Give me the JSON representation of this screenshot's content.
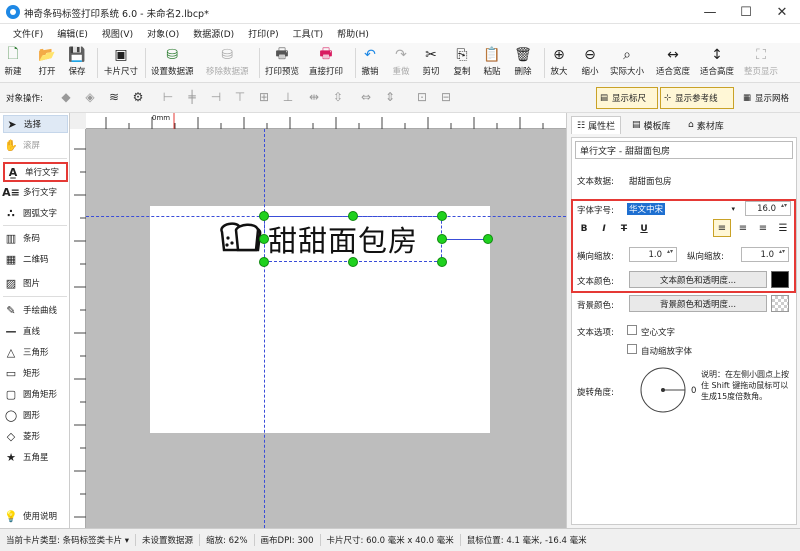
{
  "window": {
    "title": "神奇条码标签打印系统 6.0 - 未命名2.lbcp*",
    "minimize": "—",
    "maximize": "☐",
    "close": "✕"
  },
  "menu": [
    "文件(F)",
    "编辑(E)",
    "视图(V)",
    "对象(O)",
    "数据源(D)",
    "打印(P)",
    "工具(T)",
    "帮助(H)"
  ],
  "toolbar": [
    {
      "label": "新建",
      "icon": "new-file-icon",
      "glyph": "🗋"
    },
    {
      "label": "打开",
      "icon": "open-folder-icon",
      "glyph": "📂"
    },
    {
      "label": "保存",
      "icon": "save-disk-icon",
      "glyph": "💾"
    },
    {
      "label": "卡片尺寸",
      "icon": "card-size-icon",
      "glyph": "▣"
    },
    {
      "label": "设置数据源",
      "icon": "database-icon",
      "glyph": "⛁"
    },
    {
      "label": "移除数据源",
      "icon": "remove-database-icon",
      "glyph": "⛁"
    },
    {
      "label": "打印预览",
      "icon": "print-preview-icon",
      "glyph": "🖶"
    },
    {
      "label": "直接打印",
      "icon": "printer-icon",
      "glyph": "🖶"
    },
    {
      "label": "撤销",
      "icon": "undo-icon",
      "glyph": "↶"
    },
    {
      "label": "重做",
      "icon": "redo-icon",
      "glyph": "↷"
    },
    {
      "label": "剪切",
      "icon": "scissors-icon",
      "glyph": "✂"
    },
    {
      "label": "复制",
      "icon": "copy-icon",
      "glyph": "⎘"
    },
    {
      "label": "粘贴",
      "icon": "paste-icon",
      "glyph": "📋"
    },
    {
      "label": "删除",
      "icon": "trash-icon",
      "glyph": "🗑"
    },
    {
      "label": "放大",
      "icon": "zoom-in-icon",
      "glyph": "⊕"
    },
    {
      "label": "缩小",
      "icon": "zoom-out-icon",
      "glyph": "⊖"
    },
    {
      "label": "实际大小",
      "icon": "actual-size-icon",
      "glyph": "⌕"
    },
    {
      "label": "适合宽度",
      "icon": "fit-width-icon",
      "glyph": "↔"
    },
    {
      "label": "适合高度",
      "icon": "fit-height-icon",
      "glyph": "↕"
    },
    {
      "label": "整页显示",
      "icon": "full-page-icon",
      "glyph": "⛶"
    }
  ],
  "objbar": {
    "label": "对象操作:",
    "show_ruler": "显示标尺",
    "show_guides": "显示参考线",
    "show_grid": "显示网格"
  },
  "tools": [
    {
      "label": "选择",
      "glyph": "➤"
    },
    {
      "label": "滚屏",
      "glyph": "✋"
    },
    {
      "label": "单行文字",
      "glyph": "A̲"
    },
    {
      "label": "多行文字",
      "glyph": "A≡"
    },
    {
      "label": "圆弧文字",
      "glyph": "∴"
    },
    {
      "label": "条码",
      "glyph": "▥"
    },
    {
      "label": "二维码",
      "glyph": "▦"
    },
    {
      "label": "图片",
      "glyph": "▨"
    },
    {
      "label": "手绘曲线",
      "glyph": "✎"
    },
    {
      "label": "直线",
      "glyph": "—"
    },
    {
      "label": "三角形",
      "glyph": "△"
    },
    {
      "label": "矩形",
      "glyph": "▭"
    },
    {
      "label": "圆角矩形",
      "glyph": "▢"
    },
    {
      "label": "圆形",
      "glyph": "◯"
    },
    {
      "label": "菱形",
      "glyph": "◇"
    },
    {
      "label": "五角星",
      "glyph": "★"
    },
    {
      "label": "使用说明",
      "glyph": "💡"
    }
  ],
  "ruler": {
    "mm": "0mm"
  },
  "canvas": {
    "text": "甜甜面包房"
  },
  "panel": {
    "tabs": [
      "属性栏",
      "模板库",
      "素材库"
    ],
    "object_type": "单行文字 - 甜甜面包房",
    "text_data_label": "文本数据:",
    "text_data": "甜甜面包房",
    "font_label": "字体字号:",
    "font_name": "华文中宋",
    "font_size": "16.0",
    "format_buttons": [
      "B",
      "I",
      "T",
      "U"
    ],
    "hscale_label": "横向缩放:",
    "hscale": "1.0",
    "vscale_label": "纵向缩放:",
    "vscale": "1.0",
    "text_color_label": "文本颜色:",
    "text_color_btn": "文本颜色和透明度...",
    "bg_color_label": "背景颜色:",
    "bg_color_btn": "背景颜色和透明度...",
    "text_options_label": "文本选项:",
    "hollow_text": "空心文字",
    "auto_scale": "自动缩放字体",
    "rotation_label": "旋转角度:",
    "rotation_value": "0",
    "help_text": "说明：在左侧小圆点上按住 Shift 键拖动鼠标可以生成15度倍数角。"
  },
  "status": [
    "当前卡片类型: 条码标签类卡片 ▾",
    "未设置数据源",
    "缩放: 62%",
    "画布DPI: 300",
    "卡片尺寸: 60.0 毫米 x 40.0 毫米",
    "鼠标位置: 4.1 毫米, -16.4 毫米"
  ],
  "colors": {
    "accent": "#e53935",
    "handle": "#1fd11f",
    "guide": "#3a4dd8"
  }
}
